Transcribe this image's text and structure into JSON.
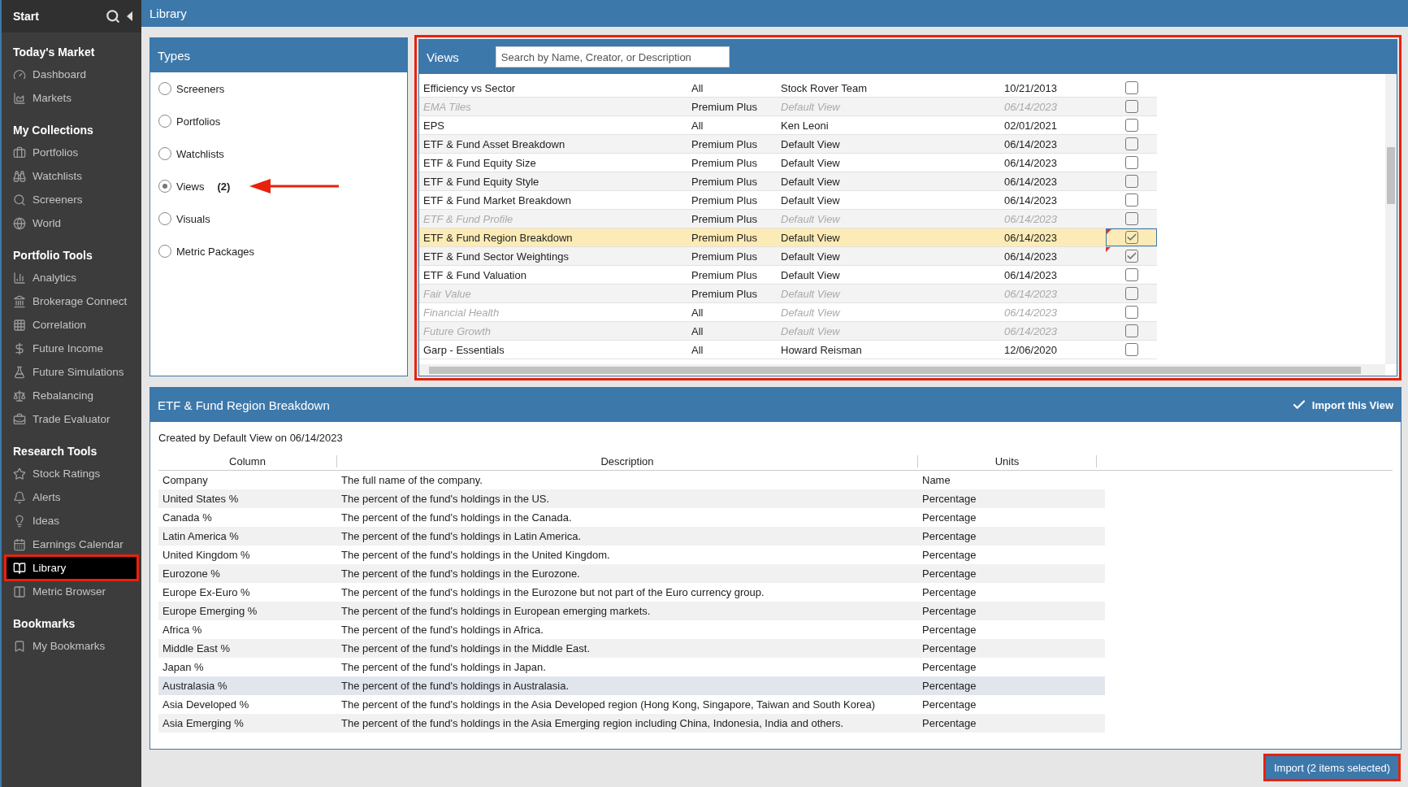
{
  "sidebar": {
    "title": "Start",
    "sections": [
      {
        "title": "Today's Market",
        "items": [
          {
            "label": "Dashboard",
            "selected": false
          },
          {
            "label": "Markets",
            "selected": false
          }
        ]
      },
      {
        "title": "My Collections",
        "items": [
          {
            "label": "Portfolios",
            "selected": false
          },
          {
            "label": "Watchlists",
            "selected": false
          },
          {
            "label": "Screeners",
            "selected": false
          },
          {
            "label": "World",
            "selected": false
          }
        ]
      },
      {
        "title": "Portfolio Tools",
        "items": [
          {
            "label": "Analytics",
            "selected": false
          },
          {
            "label": "Brokerage Connect",
            "selected": false
          },
          {
            "label": "Correlation",
            "selected": false
          },
          {
            "label": "Future Income",
            "selected": false
          },
          {
            "label": "Future Simulations",
            "selected": false
          },
          {
            "label": "Rebalancing",
            "selected": false
          },
          {
            "label": "Trade Evaluator",
            "selected": false
          }
        ]
      },
      {
        "title": "Research Tools",
        "items": [
          {
            "label": "Stock Ratings",
            "selected": false
          },
          {
            "label": "Alerts",
            "selected": false
          },
          {
            "label": "Ideas",
            "selected": false
          },
          {
            "label": "Earnings Calendar",
            "selected": false
          },
          {
            "label": "Library",
            "selected": true
          },
          {
            "label": "Metric Browser",
            "selected": false
          }
        ]
      },
      {
        "title": "Bookmarks",
        "items": [
          {
            "label": "My Bookmarks",
            "selected": false
          }
        ]
      }
    ]
  },
  "header": {
    "title": "Library"
  },
  "types": {
    "title": "Types",
    "items": [
      {
        "label": "Screeners",
        "selected": false
      },
      {
        "label": "Portfolios",
        "selected": false
      },
      {
        "label": "Watchlists",
        "selected": false
      },
      {
        "label": "Views",
        "count": "(2)",
        "selected": true
      },
      {
        "label": "Visuals",
        "selected": false
      },
      {
        "label": "Metric Packages",
        "selected": false
      }
    ]
  },
  "views": {
    "title": "Views",
    "search": {
      "placeholder": "Search by Name, Creator, or Description"
    },
    "rows": [
      {
        "name": "Efficiency vs Sector",
        "access": "All",
        "creator": "Stock Rover Team",
        "date": "10/21/2013",
        "checked": false,
        "disabled": false,
        "selected": false
      },
      {
        "name": "EMA Tiles",
        "access": "Premium Plus",
        "creator": "Default View",
        "date": "06/14/2023",
        "checked": false,
        "disabled": true,
        "selected": false
      },
      {
        "name": "EPS",
        "access": "All",
        "creator": "Ken Leoni",
        "date": "02/01/2021",
        "checked": false,
        "disabled": false,
        "selected": false
      },
      {
        "name": "ETF & Fund Asset Breakdown",
        "access": "Premium Plus",
        "creator": "Default View",
        "date": "06/14/2023",
        "checked": false,
        "disabled": false,
        "selected": false
      },
      {
        "name": "ETF & Fund Equity Size",
        "access": "Premium Plus",
        "creator": "Default View",
        "date": "06/14/2023",
        "checked": false,
        "disabled": false,
        "selected": false
      },
      {
        "name": "ETF & Fund Equity Style",
        "access": "Premium Plus",
        "creator": "Default View",
        "date": "06/14/2023",
        "checked": false,
        "disabled": false,
        "selected": false
      },
      {
        "name": "ETF & Fund Market Breakdown",
        "access": "Premium Plus",
        "creator": "Default View",
        "date": "06/14/2023",
        "checked": false,
        "disabled": false,
        "selected": false
      },
      {
        "name": "ETF & Fund Profile",
        "access": "Premium Plus",
        "creator": "Default View",
        "date": "06/14/2023",
        "checked": false,
        "disabled": true,
        "selected": false
      },
      {
        "name": "ETF & Fund Region Breakdown",
        "access": "Premium Plus",
        "creator": "Default View",
        "date": "06/14/2023",
        "checked": true,
        "disabled": false,
        "selected": true
      },
      {
        "name": "ETF & Fund Sector Weightings",
        "access": "Premium Plus",
        "creator": "Default View",
        "date": "06/14/2023",
        "checked": true,
        "disabled": false,
        "selected": false
      },
      {
        "name": "ETF & Fund Valuation",
        "access": "Premium Plus",
        "creator": "Default View",
        "date": "06/14/2023",
        "checked": false,
        "disabled": false,
        "selected": false
      },
      {
        "name": "Fair Value",
        "access": "Premium Plus",
        "creator": "Default View",
        "date": "06/14/2023",
        "checked": false,
        "disabled": true,
        "selected": false
      },
      {
        "name": "Financial Health",
        "access": "All",
        "creator": "Default View",
        "date": "06/14/2023",
        "checked": false,
        "disabled": true,
        "selected": false
      },
      {
        "name": "Future Growth",
        "access": "All",
        "creator": "Default View",
        "date": "06/14/2023",
        "checked": false,
        "disabled": true,
        "selected": false
      },
      {
        "name": "Garp - Essentials",
        "access": "All",
        "creator": "Howard Reisman",
        "date": "12/06/2020",
        "checked": false,
        "disabled": false,
        "selected": false
      }
    ]
  },
  "detail": {
    "title": "ETF & Fund Region Breakdown",
    "import_view": {
      "label": "Import this View",
      "checked": true
    },
    "created": "Created by Default View on 06/14/2023",
    "columns": [
      "Column",
      "Description",
      "Units"
    ],
    "rows": [
      {
        "column": "Company",
        "description": "The full name of the company.",
        "units": "Name",
        "selected": false
      },
      {
        "column": "United States %",
        "description": "The percent of the fund's holdings in the US.",
        "units": "Percentage",
        "selected": false
      },
      {
        "column": "Canada %",
        "description": "The percent of the fund's holdings in the Canada.",
        "units": "Percentage",
        "selected": false
      },
      {
        "column": "Latin America %",
        "description": "The percent of the fund's holdings in Latin America.",
        "units": "Percentage",
        "selected": false
      },
      {
        "column": "United Kingdom %",
        "description": "The percent of the fund's holdings in the United Kingdom.",
        "units": "Percentage",
        "selected": false
      },
      {
        "column": "Eurozone %",
        "description": "The percent of the fund's holdings in the Eurozone.",
        "units": "Percentage",
        "selected": false
      },
      {
        "column": "Europe Ex-Euro %",
        "description": "The percent of the fund's holdings in the Eurozone but not part of the Euro currency group.",
        "units": "Percentage",
        "selected": false
      },
      {
        "column": "Europe Emerging %",
        "description": "The percent of the fund's holdings in European emerging markets.",
        "units": "Percentage",
        "selected": false
      },
      {
        "column": "Africa %",
        "description": "The percent of the fund's holdings in Africa.",
        "units": "Percentage",
        "selected": false
      },
      {
        "column": "Middle East %",
        "description": "The percent of the fund's holdings in the Middle East.",
        "units": "Percentage",
        "selected": false
      },
      {
        "column": "Japan %",
        "description": "The percent of the fund's holdings in Japan.",
        "units": "Percentage",
        "selected": false
      },
      {
        "column": "Australasia %",
        "description": "The percent of the fund's holdings in Australasia.",
        "units": "Percentage",
        "selected": true
      },
      {
        "column": "Asia Developed %",
        "description": "The percent of the fund's holdings in the Asia Developed region (Hong Kong, Singapore, Taiwan and South Korea)",
        "units": "Percentage",
        "selected": false
      },
      {
        "column": "Asia Emerging %",
        "description": "The percent of the fund's holdings in the Asia Emerging region including China, Indonesia, India and others.",
        "units": "Percentage",
        "selected": false
      }
    ]
  },
  "import_button": {
    "label": "Import (2 items selected)"
  }
}
